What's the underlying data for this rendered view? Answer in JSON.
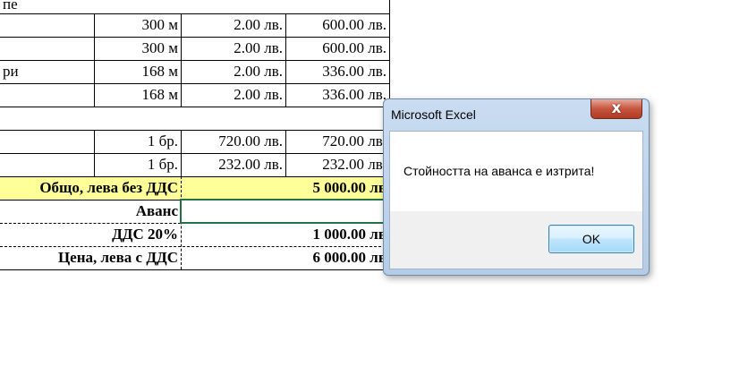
{
  "sheet": {
    "header_fragment": "пе",
    "rows": [
      {
        "desc": "",
        "qty": "300 м",
        "price": "2.00 лв.",
        "total": "600.00 лв."
      },
      {
        "desc": "",
        "qty": "300 м",
        "price": "2.00 лв.",
        "total": "600.00 лв."
      },
      {
        "desc": "ри",
        "qty": "168 м",
        "price": "2.00 лв.",
        "total": "336.00 лв."
      },
      {
        "desc": "",
        "qty": "168 м",
        "price": "2.00 лв.",
        "total": "336.00 лв."
      },
      {
        "desc": "",
        "qty": "",
        "price": "",
        "total": ""
      },
      {
        "desc": "",
        "qty": "1 бр.",
        "price": "720.00 лв.",
        "total": "720.00 лв."
      },
      {
        "desc": "",
        "qty": "1 бр.",
        "price": "232.00 лв.",
        "total": "232.00 лв."
      }
    ],
    "summary": {
      "subtotal_label": "Общо, лева без ДДС",
      "subtotal_value": "5 000.00 лв",
      "advance_label": "Аванс",
      "advance_value": "",
      "vat_label": "ДДС 20%",
      "vat_value": "1 000.00 лв",
      "total_label": "Цена, лева с ДДС",
      "total_value": "6 000.00 лв"
    }
  },
  "dialog": {
    "title": "Microsoft Excel",
    "close_label": "x",
    "message": "Стойността на аванса е изтрита!",
    "ok_label": "OK"
  },
  "colors": {
    "highlight_yellow": "#ffff99",
    "selection_green": "#217346",
    "dialog_frame": "#b6cce6",
    "close_red": "#c6553f"
  }
}
